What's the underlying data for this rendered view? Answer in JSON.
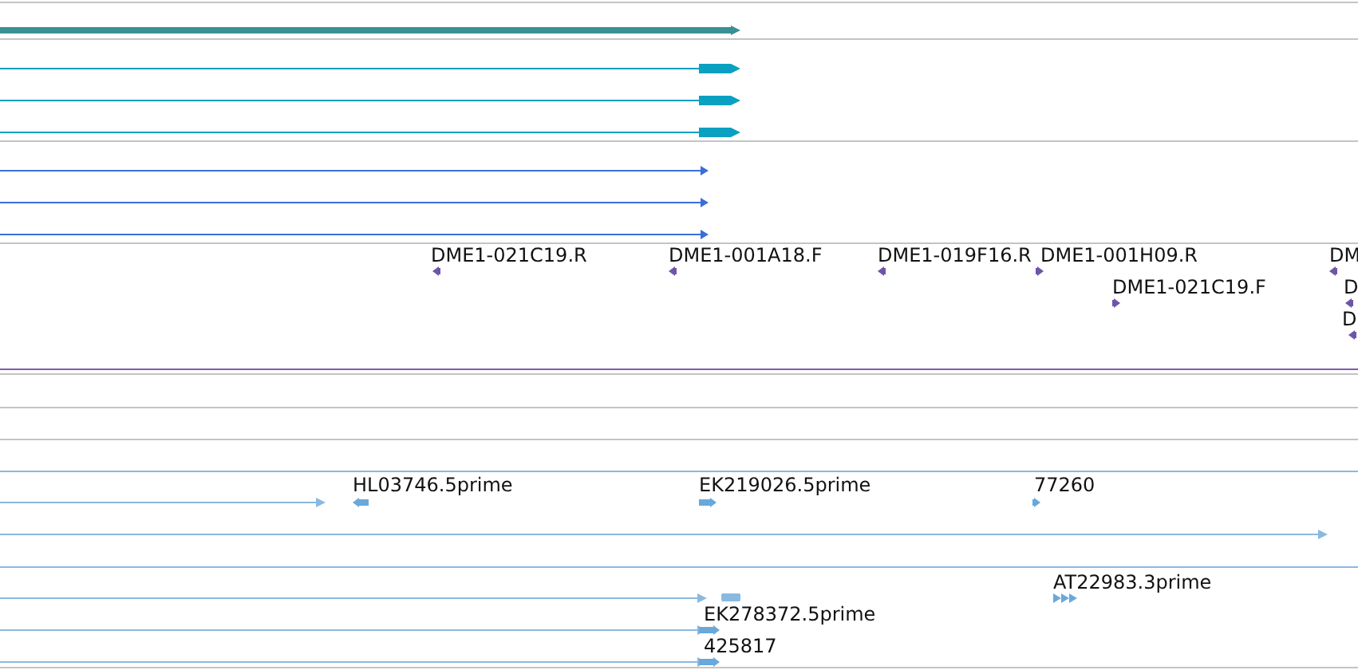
{
  "clone_track": {
    "features": [
      {
        "label": "DME1-021C19.R",
        "reverse": true
      },
      {
        "label": "DME1-001A18.F",
        "reverse": true
      },
      {
        "label": "DME1-019F16.R",
        "reverse": true
      },
      {
        "label": "DME1-001H09.R",
        "reverse": false
      },
      {
        "label": "DME1-021C19.F",
        "reverse": false
      },
      {
        "label": "DM",
        "reverse": true
      },
      {
        "label": "D",
        "reverse": true
      },
      {
        "label": "D",
        "reverse": true
      }
    ]
  },
  "est_track": {
    "features": [
      {
        "label": "HL03746.5prime",
        "reverse": true
      },
      {
        "label": "EK219026.5prime",
        "reverse": false
      },
      {
        "label": "77260",
        "reverse": false
      },
      {
        "label": "AT22983.3prime",
        "reverse": false
      },
      {
        "label": "EK278372.5prime",
        "reverse": false
      },
      {
        "label": "425817",
        "reverse": false
      }
    ]
  }
}
